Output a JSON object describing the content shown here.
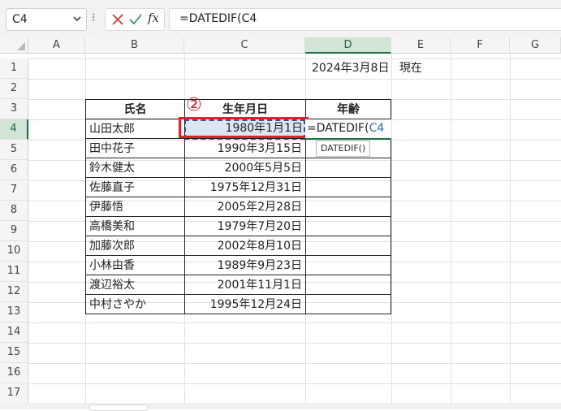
{
  "formula_bar": {
    "name_box": "C4",
    "formula": "=DATEDIF(C4",
    "fx_label": "fx",
    "more_label": "⁝"
  },
  "columns": [
    "A",
    "B",
    "C",
    "D",
    "E",
    "F",
    "G"
  ],
  "rows": [
    "1",
    "2",
    "3",
    "4",
    "5",
    "6",
    "7",
    "8",
    "9",
    "10",
    "11",
    "12",
    "13",
    "14",
    "15",
    "16",
    "17"
  ],
  "current_date": {
    "date": "2024年3月8日",
    "suffix": "現在"
  },
  "table": {
    "headers": {
      "name": "氏名",
      "birthdate": "生年月日",
      "age": "年齢"
    },
    "records": [
      {
        "name": "山田太郎",
        "birthdate": "1980年1月1日"
      },
      {
        "name": "田中花子",
        "birthdate": "1990年3月15日"
      },
      {
        "name": "鈴木健太",
        "birthdate": "2000年5月5日"
      },
      {
        "name": "佐藤直子",
        "birthdate": "1975年12月31日"
      },
      {
        "name": "伊藤悟",
        "birthdate": "2005年2月28日"
      },
      {
        "name": "高橋美和",
        "birthdate": "1979年7月20日"
      },
      {
        "name": "加藤次郎",
        "birthdate": "2002年8月10日"
      },
      {
        "name": "小林由香",
        "birthdate": "1989年9月23日"
      },
      {
        "name": "渡辺裕太",
        "birthdate": "2001年11月1日"
      },
      {
        "name": "中村さやか",
        "birthdate": "1995年12月24日"
      }
    ]
  },
  "editing": {
    "prefix": "=DATEDIF(",
    "ref": "C4",
    "tooltip": "DATEDIF()"
  },
  "annotation": {
    "step": "②"
  },
  "colors": {
    "accent_green": "#1e7145",
    "highlight_red": "#e0202a",
    "ref_blue": "#2f6fb8"
  }
}
